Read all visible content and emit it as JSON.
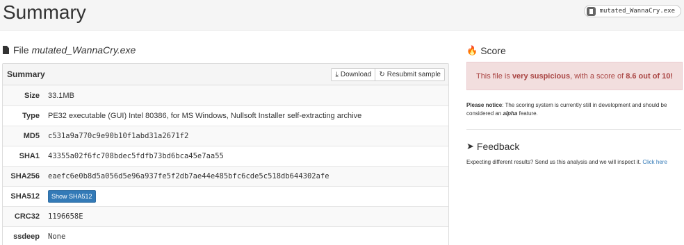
{
  "header": {
    "title": "Summary",
    "file_pill": "mutated_WannaCry.exe"
  },
  "file_heading": {
    "label": "File",
    "filename": "mutated_WannaCry.exe"
  },
  "panel": {
    "title": "Summary",
    "download_label": "Download",
    "resubmit_label": "Resubmit sample",
    "rows": [
      {
        "key": "Size",
        "value": "33.1MB"
      },
      {
        "key": "Type",
        "value": "PE32 executable (GUI) Intel 80386, for MS Windows, Nullsoft Installer self-extracting archive"
      },
      {
        "key": "MD5",
        "value": "c531a9a770c9e90b10f1abd31a2671f2"
      },
      {
        "key": "SHA1",
        "value": "43355a02f6fc708bdec5fdfb73bd6bca45e7aa55"
      },
      {
        "key": "SHA256",
        "value": "eaefc6e0b8d5a056d5e96a937fe5f2db7ae44e485bfc6cde5c518db644302afe"
      },
      {
        "key": "SHA512",
        "button": "Show SHA512"
      },
      {
        "key": "CRC32",
        "value": "1196658E"
      },
      {
        "key": "ssdeep",
        "value": "None"
      }
    ]
  },
  "score": {
    "heading": "Score",
    "alert_prefix": "This file is ",
    "alert_emph": "very suspicious",
    "alert_mid": ", with a score of ",
    "alert_score": "8.6 out of 10!",
    "notice_label": "Please notice",
    "notice_text_1": ": The scoring system is currently still in development and should be considered an ",
    "notice_emph": "alpha",
    "notice_text_2": " feature."
  },
  "feedback": {
    "heading": "Feedback",
    "text": "Expecting different results? Send us this analysis and we will inspect it. ",
    "link": "Click here"
  },
  "colors": {
    "alert_bg": "#f2dede",
    "alert_text": "#a94442",
    "primary": "#337ab7"
  }
}
